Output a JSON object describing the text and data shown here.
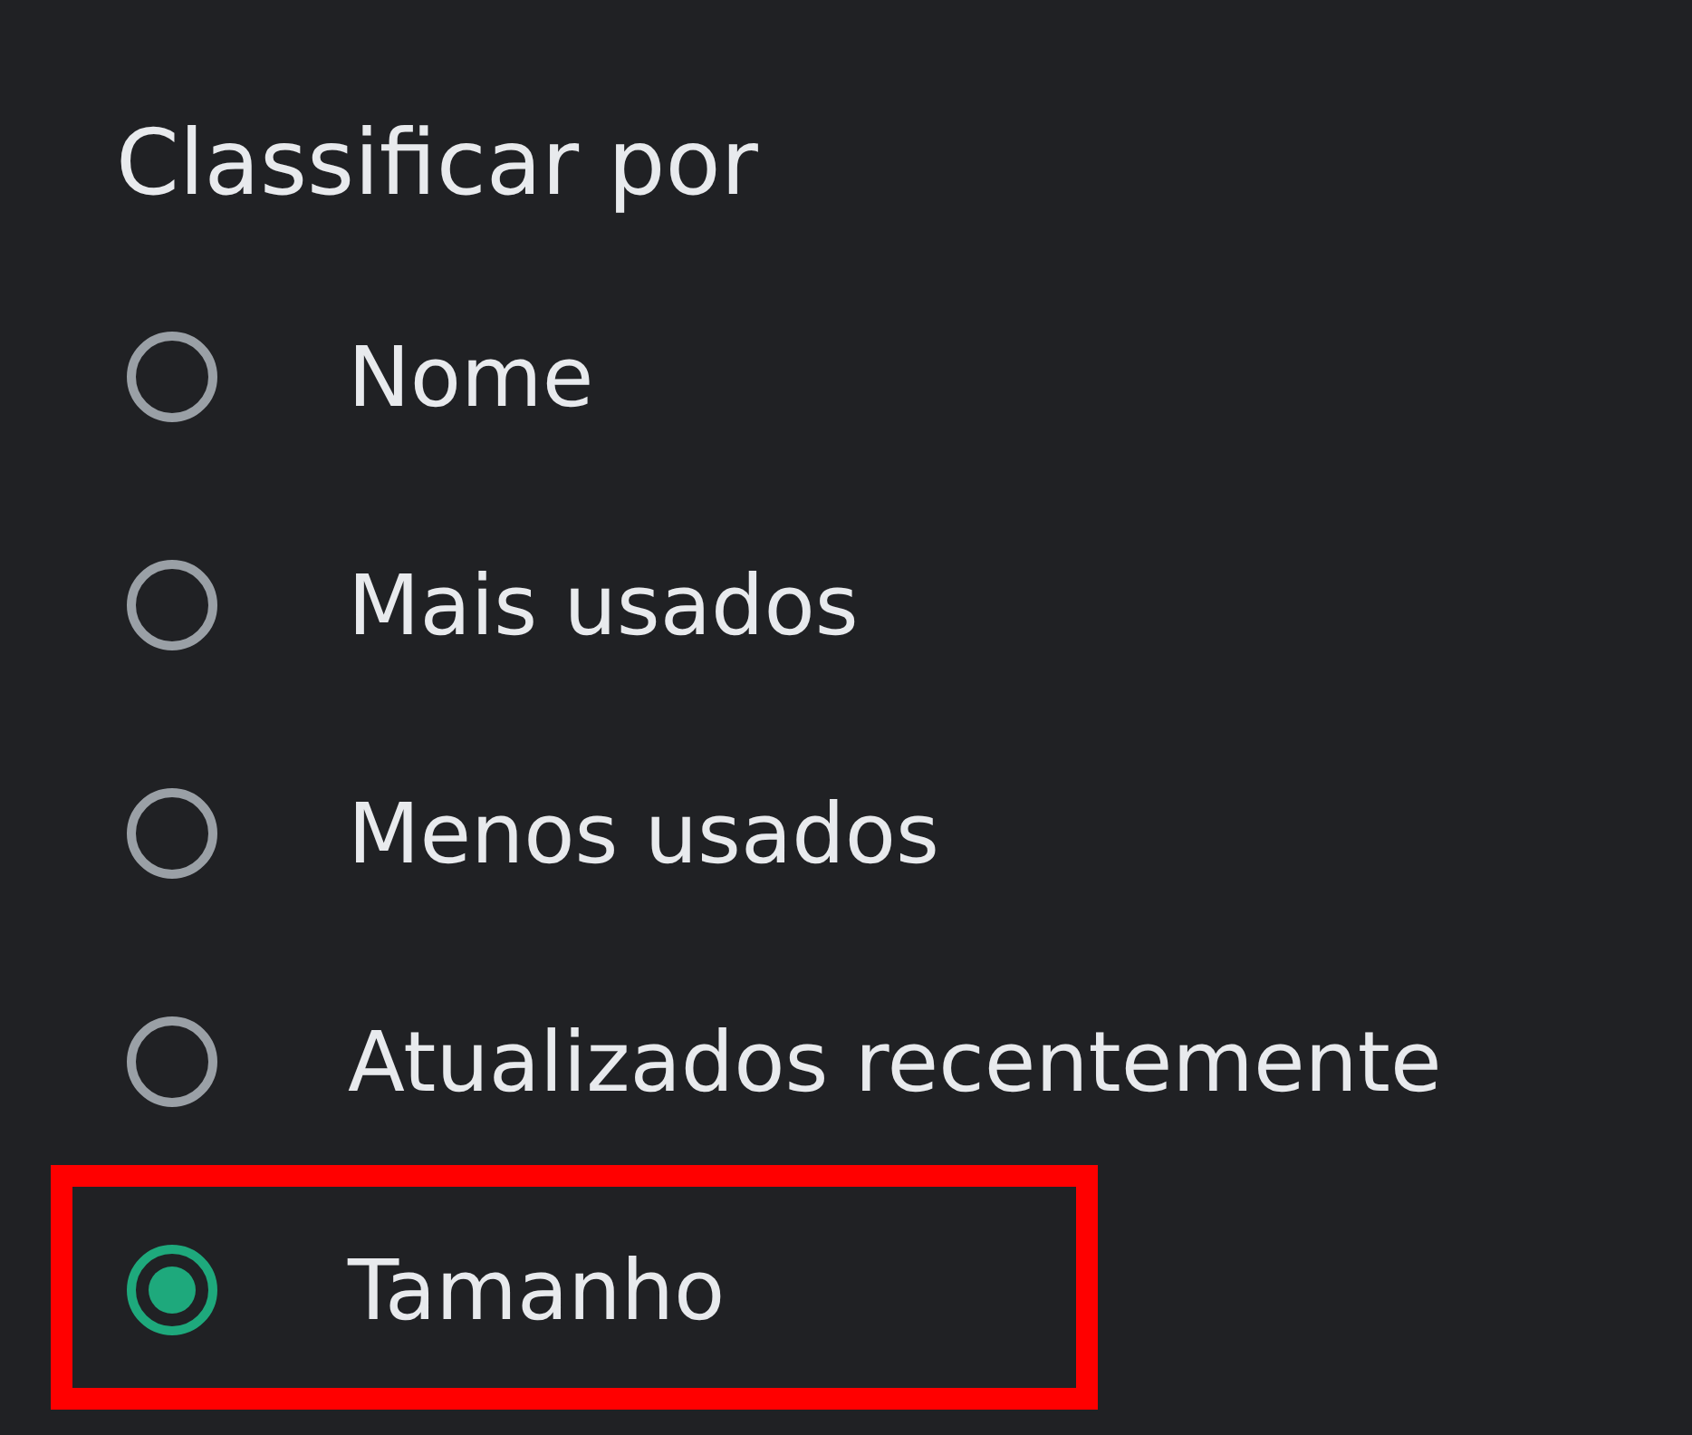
{
  "dialog": {
    "title": "Classificar por",
    "options": [
      {
        "label": "Nome",
        "selected": false,
        "highlighted": false
      },
      {
        "label": "Mais usados",
        "selected": false,
        "highlighted": false
      },
      {
        "label": "Menos usados",
        "selected": false,
        "highlighted": false
      },
      {
        "label": "Atualizados recentemente",
        "selected": false,
        "highlighted": false
      },
      {
        "label": "Tamanho",
        "selected": true,
        "highlighted": true
      }
    ]
  }
}
